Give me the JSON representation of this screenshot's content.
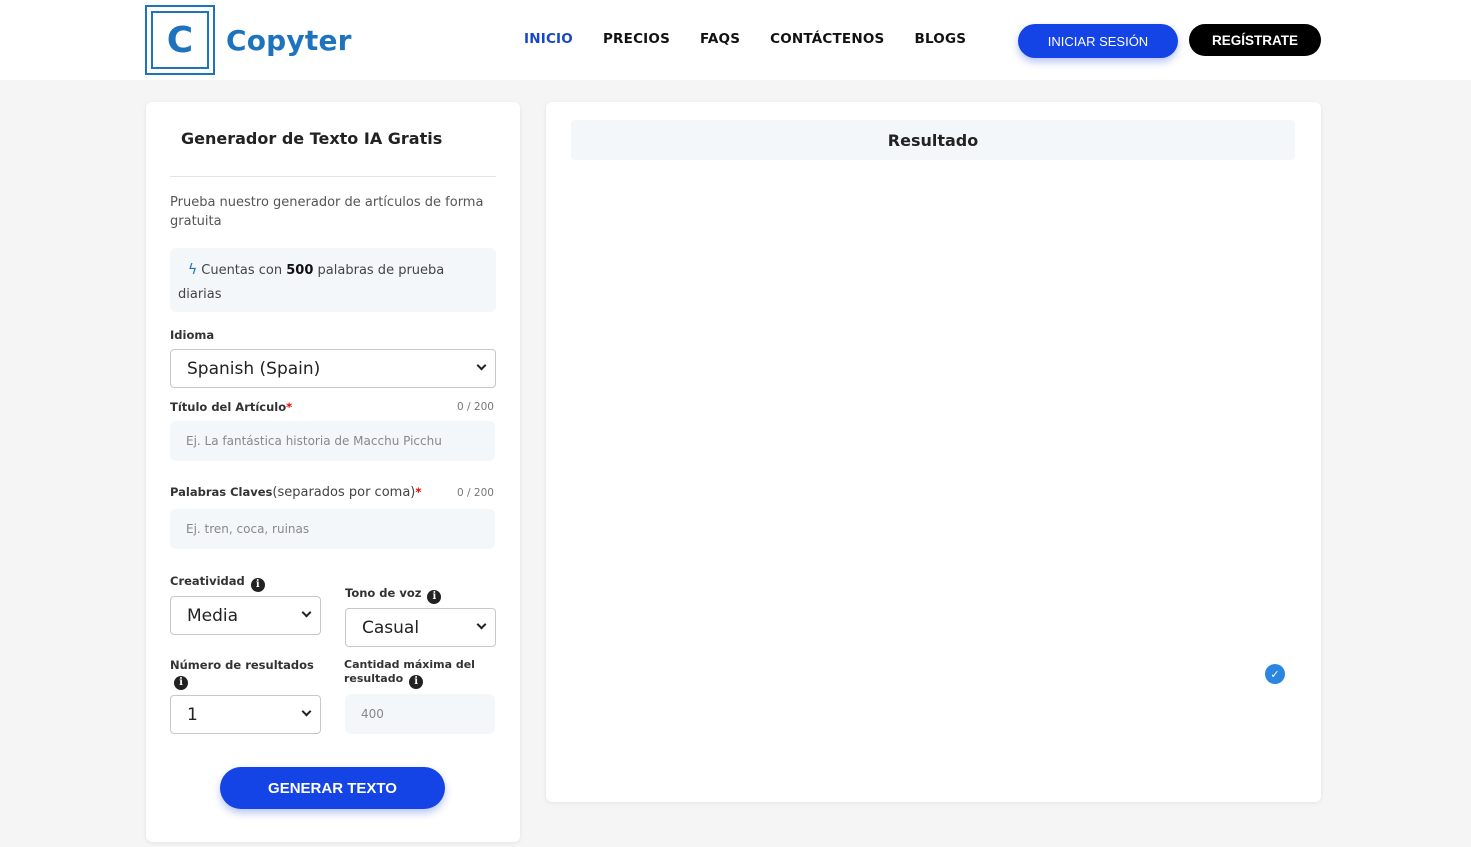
{
  "header": {
    "logo_letter": "C",
    "brand": "Copyter",
    "nav": [
      "INICIO",
      "PRECIOS",
      "FAQS",
      "CONTÁCTENOS",
      "BLOGS"
    ],
    "login_label": "INICIAR SESIÓN",
    "register_label": "REGÍSTRATE"
  },
  "form": {
    "title": "Generador de Texto IA Gratis",
    "description": "Prueba nuestro generador de artículos de forma gratuita",
    "info_prefix": "Cuentas con",
    "info_count": "500",
    "info_suffix": "palabras de prueba diarias",
    "language_label": "Idioma",
    "language_value": "Spanish (Spain)",
    "title_label": "Título del Artículo",
    "title_counter": "0 / 200",
    "title_placeholder": "Ej. La fantástica historia de Macchu Picchu",
    "keywords_label": "Palabras Claves",
    "keywords_hint": "(separados por coma)",
    "keywords_counter": "0 / 200",
    "keywords_placeholder": "Ej. tren, coca, ruinas",
    "creativity_label": "Creatividad",
    "creativity_value": "Media",
    "tone_label": "Tono de voz",
    "tone_value": "Casual",
    "results_label": "Número de resultados",
    "results_value": "1",
    "max_label_1": "Cantidad máxima del",
    "max_label_2": "resultado",
    "max_value": "400",
    "generate_label": "GENERAR TEXTO",
    "required_mark": "*"
  },
  "result": {
    "title": "Resultado"
  },
  "colors": {
    "brand": "#1e73be",
    "primary_button": "#1443e6",
    "active_nav": "#1746c9"
  }
}
